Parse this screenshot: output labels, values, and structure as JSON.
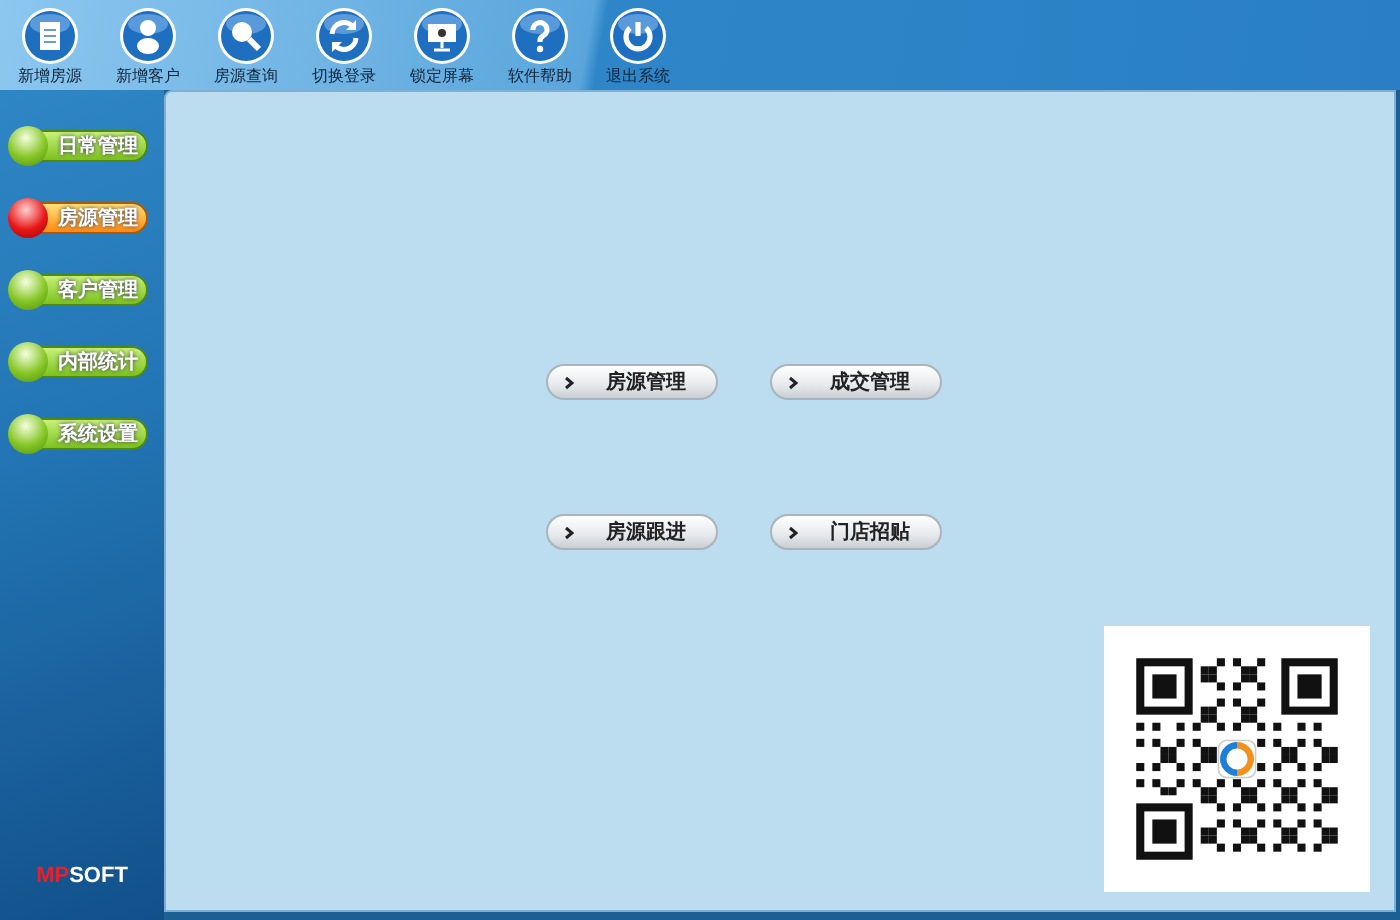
{
  "toolbar": {
    "items": [
      {
        "label": "新增房源"
      },
      {
        "label": "新增客户"
      },
      {
        "label": "房源查询"
      },
      {
        "label": "切换登录"
      },
      {
        "label": "锁定屏幕"
      },
      {
        "label": "软件帮助"
      },
      {
        "label": "退出系统"
      }
    ]
  },
  "sidebar": {
    "items": [
      {
        "label": "日常管理",
        "selected": false
      },
      {
        "label": "房源管理",
        "selected": true
      },
      {
        "label": "客户管理",
        "selected": false
      },
      {
        "label": "内部统计",
        "selected": false
      },
      {
        "label": "系统设置",
        "selected": false
      }
    ],
    "logo": {
      "parts": [
        "MP",
        "SOFT"
      ]
    }
  },
  "main": {
    "buttons": [
      {
        "label": "房源管理"
      },
      {
        "label": "成交管理"
      },
      {
        "label": "房源跟进"
      },
      {
        "label": "门店招贴"
      }
    ]
  }
}
